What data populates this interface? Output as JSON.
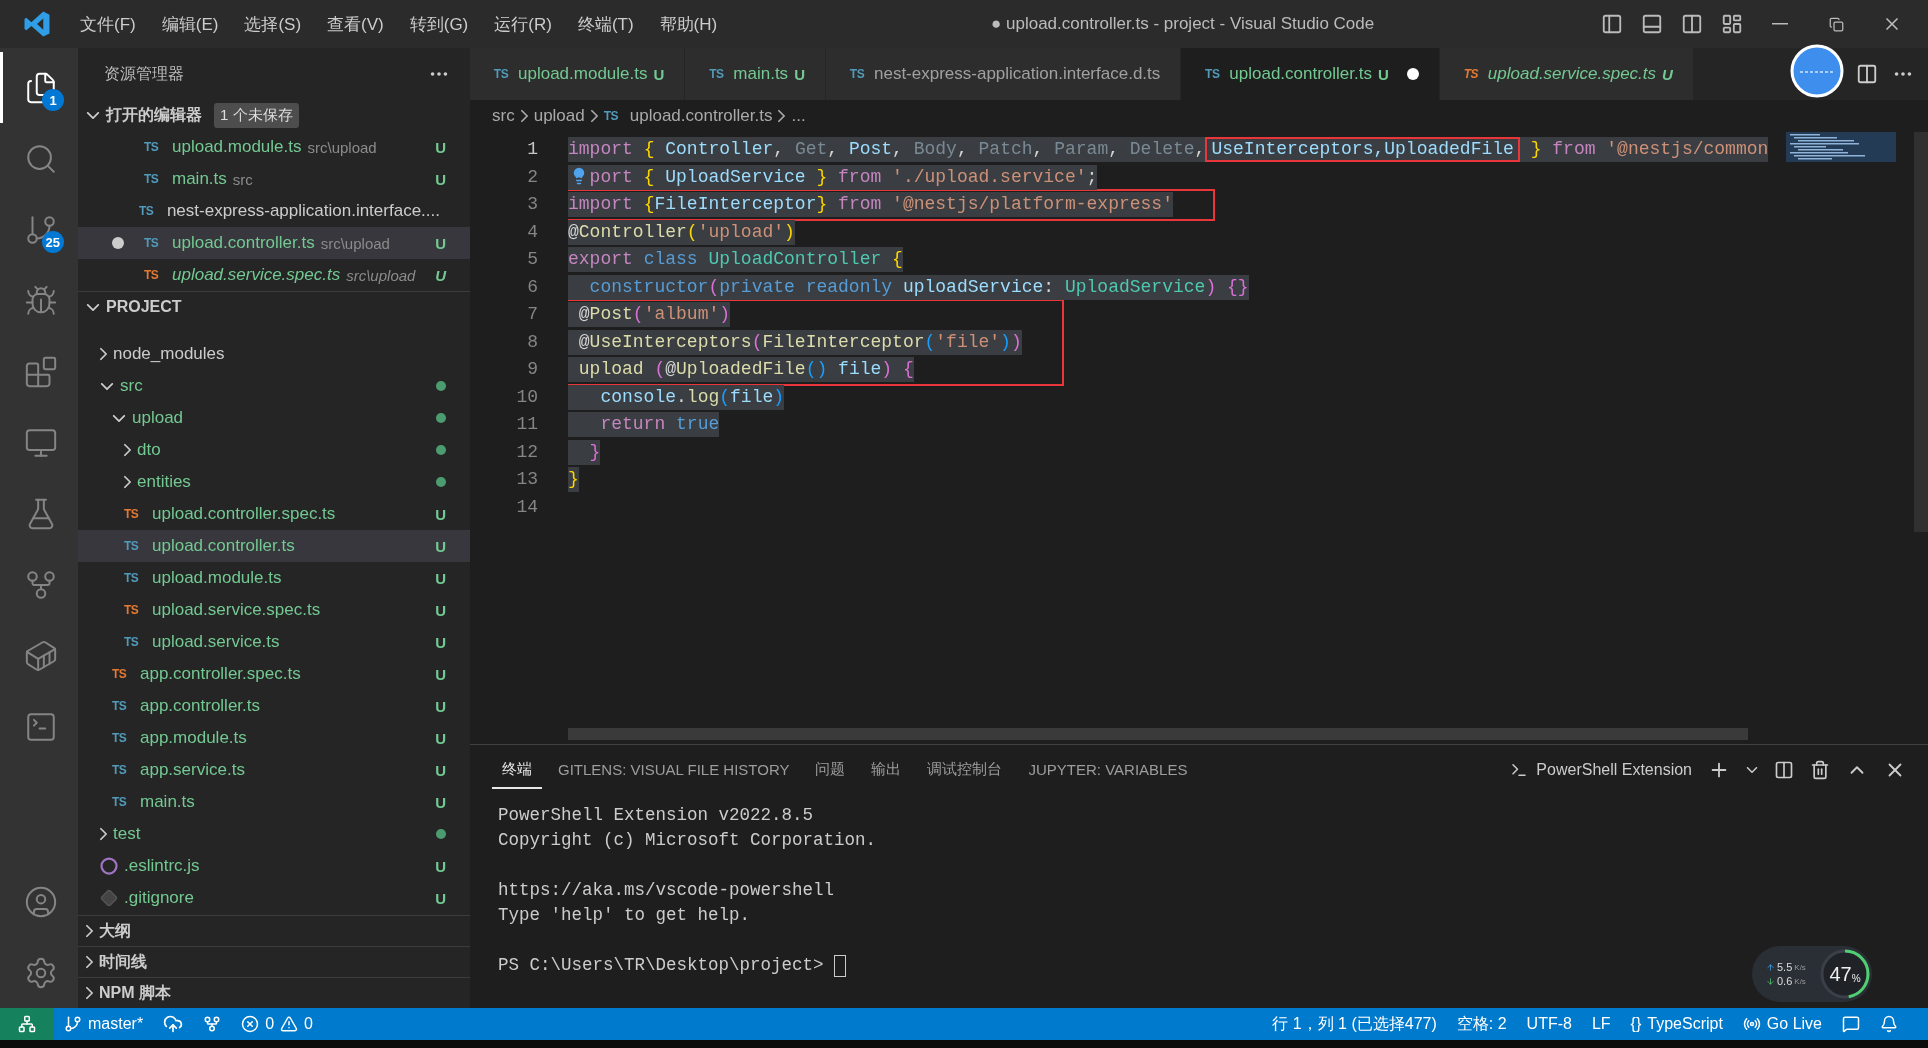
{
  "title_bar": {
    "menu": [
      "文件(F)",
      "编辑(E)",
      "选择(S)",
      "查看(V)",
      "转到(G)",
      "运行(R)",
      "终端(T)",
      "帮助(H)"
    ],
    "title": "● upload.controller.ts - project - Visual Studio Code"
  },
  "activity_bar": {
    "top": [
      {
        "kind": "explorer",
        "badge": "1",
        "selected": true
      },
      {
        "kind": "search",
        "selected": false
      },
      {
        "kind": "scm",
        "badge": "25",
        "selected": false
      },
      {
        "kind": "debug",
        "selected": false
      },
      {
        "kind": "extensions",
        "selected": false
      },
      {
        "kind": "remote",
        "selected": false
      },
      {
        "kind": "testing",
        "selected": false
      },
      {
        "kind": "gitgraph",
        "selected": false
      },
      {
        "kind": "docker",
        "selected": false
      },
      {
        "kind": "terminal",
        "selected": false
      }
    ],
    "bottom": [
      {
        "kind": "account",
        "selected": false
      },
      {
        "kind": "settings",
        "selected": false
      }
    ]
  },
  "sidebar": {
    "title": "资源管理器",
    "open_editors": {
      "title": "打开的编辑器",
      "badge": "1 个未保存",
      "expanded": true,
      "items": [
        {
          "icon": "TS",
          "kind": "ts",
          "name": "upload.module.ts",
          "description": "src\\upload",
          "status": "U",
          "dirty": false,
          "selected": false,
          "preview": false
        },
        {
          "icon": "TS",
          "kind": "ts",
          "name": "main.ts",
          "description": "src",
          "status": "U",
          "dirty": false,
          "selected": false,
          "preview": false
        },
        {
          "icon": "TS",
          "kind": "ts",
          "name": "nest-express-application.interface....",
          "dirty": false,
          "selected": false,
          "preview": false
        },
        {
          "icon": "TS",
          "kind": "ts",
          "name": "upload.controller.ts",
          "description": "src\\upload",
          "status": "U",
          "dirty": true,
          "selected": true,
          "preview": false
        },
        {
          "icon": "TS",
          "kind": "spec",
          "name": "upload.service.spec.ts",
          "description": "src\\upload",
          "status": "U",
          "dirty": false,
          "selected": false,
          "preview": true
        }
      ]
    },
    "project": {
      "title": "PROJECT",
      "expanded": true,
      "tree": [
        {
          "kind": "folder",
          "name": "node_modules",
          "expanded": false,
          "git_dot": false,
          "selected": false
        },
        {
          "kind": "folder",
          "name": "src",
          "expanded": true,
          "git_dot": true,
          "selected": false,
          "children": [
            {
              "kind": "folder",
              "name": "upload",
              "expanded": true,
              "git_dot": true,
              "selected": false,
              "children": [
                {
                  "kind": "folder",
                  "name": "dto",
                  "expanded": false,
                  "git_dot": true,
                  "selected": false
                },
                {
                  "kind": "folder",
                  "name": "entities",
                  "expanded": false,
                  "git_dot": true,
                  "selected": false
                },
                {
                  "kind": "spec",
                  "icon": "TS",
                  "name": "upload.controller.spec.ts",
                  "status": "U",
                  "selected": false
                },
                {
                  "kind": "ts",
                  "icon": "TS",
                  "name": "upload.controller.ts",
                  "status": "U",
                  "selected": true
                },
                {
                  "kind": "ts",
                  "icon": "TS",
                  "name": "upload.module.ts",
                  "status": "U",
                  "selected": false
                },
                {
                  "kind": "spec",
                  "icon": "TS",
                  "name": "upload.service.spec.ts",
                  "status": "U",
                  "selected": false
                },
                {
                  "kind": "ts",
                  "icon": "TS",
                  "name": "upload.service.ts",
                  "status": "U",
                  "selected": false
                }
              ]
            },
            {
              "kind": "spec",
              "icon": "TS",
              "name": "app.controller.spec.ts",
              "status": "U",
              "selected": false
            },
            {
              "kind": "ts",
              "icon": "TS",
              "name": "app.controller.ts",
              "status": "U",
              "selected": false
            },
            {
              "kind": "ts",
              "icon": "TS",
              "name": "app.module.ts",
              "status": "U",
              "selected": false
            },
            {
              "kind": "ts",
              "icon": "TS",
              "name": "app.service.ts",
              "status": "U",
              "selected": false
            },
            {
              "kind": "ts",
              "icon": "TS",
              "name": "main.ts",
              "status": "U",
              "selected": false
            }
          ]
        },
        {
          "kind": "folder",
          "name": "test",
          "expanded": false,
          "git_dot": true,
          "selected": false
        },
        {
          "kind": "eslint",
          "name": ".eslintrc.js",
          "status": "U",
          "selected": false
        },
        {
          "kind": "git",
          "name": ".gitignore",
          "status": "U",
          "selected": false
        }
      ]
    },
    "sections": [
      {
        "title": "大纲",
        "expanded": false
      },
      {
        "title": "时间线",
        "expanded": false
      },
      {
        "title": "NPM 脚本",
        "expanded": false
      }
    ]
  },
  "editor": {
    "tabs": [
      {
        "icon": "TS",
        "kind": "ts",
        "label": "upload.module.ts",
        "status": "U",
        "dirty": false,
        "selected": false,
        "preview": false
      },
      {
        "icon": "TS",
        "kind": "ts",
        "label": "main.ts",
        "status": "U",
        "dirty": false,
        "selected": false,
        "preview": false
      },
      {
        "icon": "TS",
        "kind": "ts",
        "label": "nest-express-application.interface.d.ts",
        "dirty": false,
        "selected": false,
        "preview": false
      },
      {
        "icon": "TS",
        "kind": "ts",
        "label": "upload.controller.ts",
        "status": "U",
        "dirty": true,
        "selected": true,
        "preview": false
      },
      {
        "icon": "TS",
        "kind": "spec",
        "label": "upload.service.spec.ts",
        "status": "U",
        "dirty": false,
        "selected": false,
        "preview": true
      }
    ],
    "breadcrumbs": [
      {
        "kind": "folder",
        "text": "src"
      },
      {
        "kind": "folder",
        "text": "upload"
      },
      {
        "kind": "file",
        "icon": "TS",
        "text": "upload.controller.ts"
      },
      {
        "kind": "more",
        "text": "..."
      }
    ],
    "blocks": [
      {
        "boxed": false,
        "lines": [
          {
            "number": "1",
            "current": true,
            "selected": true,
            "lightbulb": false,
            "tokens": [
              {
                "kind": "keyword",
                "text": "import "
              },
              {
                "kind": "bracket1",
                "text": "{"
              },
              {
                "kind": "variable",
                "text": " Controller"
              },
              {
                "kind": "plain",
                "text": ", "
              },
              {
                "kind": "unused",
                "text": "Get"
              },
              {
                "kind": "plain",
                "text": ", "
              },
              {
                "kind": "variable",
                "text": "Post"
              },
              {
                "kind": "plain",
                "text": ", "
              },
              {
                "kind": "unused",
                "text": "Body"
              },
              {
                "kind": "plain",
                "text": ", "
              },
              {
                "kind": "unused",
                "text": "Patch"
              },
              {
                "kind": "plain",
                "text": ", "
              },
              {
                "kind": "unused",
                "text": "Param"
              },
              {
                "kind": "plain",
                "text": ", "
              },
              {
                "kind": "unused",
                "text": "Delete"
              },
              {
                "kind": "plain",
                "text": ","
              },
              {
                "kind": "variable",
                "text": "UseInterceptors,UploadedFile",
                "boxed": true
              },
              {
                "kind": "bracket1",
                "text": " }"
              },
              {
                "kind": "keyword",
                "text": " from "
              },
              {
                "kind": "string",
                "text": "'@nestjs/common"
              }
            ]
          },
          {
            "number": "2",
            "current": false,
            "selected": true,
            "lightbulb": true,
            "tokens": [
              {
                "kind": "keyword",
                "text": "port "
              },
              {
                "kind": "bracket1",
                "text": "{"
              },
              {
                "kind": "variable",
                "text": " UploadService "
              },
              {
                "kind": "bracket1",
                "text": "}"
              },
              {
                "kind": "keyword",
                "text": " from "
              },
              {
                "kind": "string",
                "text": "'./upload.service'"
              },
              {
                "kind": "plain",
                "text": ";"
              }
            ]
          }
        ]
      },
      {
        "boxed": true,
        "lines": [
          {
            "number": "3",
            "current": false,
            "selected": true,
            "lightbulb": false,
            "tokens": [
              {
                "kind": "keyword",
                "text": "import "
              },
              {
                "kind": "bracket1",
                "text": "{"
              },
              {
                "kind": "variable",
                "text": "FileInterceptor"
              },
              {
                "kind": "bracket1",
                "text": "}"
              },
              {
                "kind": "keyword",
                "text": " from "
              },
              {
                "kind": "string",
                "text": "'@nestjs/platform-express'"
              }
            ]
          }
        ]
      },
      {
        "boxed": false,
        "lines": [
          {
            "number": "4",
            "current": false,
            "selected": true,
            "lightbulb": false,
            "tokens": [
              {
                "kind": "plain",
                "text": "@"
              },
              {
                "kind": "function",
                "text": "Controller"
              },
              {
                "kind": "bracket1",
                "text": "("
              },
              {
                "kind": "string",
                "text": "'upload'"
              },
              {
                "kind": "bracket1",
                "text": ")"
              }
            ]
          },
          {
            "number": "5",
            "current": false,
            "selected": true,
            "lightbulb": false,
            "tokens": [
              {
                "kind": "keyword",
                "text": "export "
              },
              {
                "kind": "storage",
                "text": "class "
              },
              {
                "kind": "type",
                "text": "UploadController "
              },
              {
                "kind": "bracket1",
                "text": "{"
              }
            ]
          },
          {
            "number": "6",
            "current": false,
            "selected": true,
            "lightbulb": false,
            "tokens": [
              {
                "kind": "storage",
                "text": "  constructor"
              },
              {
                "kind": "bracket2",
                "text": "("
              },
              {
                "kind": "storage",
                "text": "private readonly "
              },
              {
                "kind": "variable",
                "text": "uploadService"
              },
              {
                "kind": "plain",
                "text": ": "
              },
              {
                "kind": "type",
                "text": "UploadService"
              },
              {
                "kind": "bracket2",
                "text": ") {}"
              }
            ]
          }
        ]
      },
      {
        "boxed": true,
        "lines": [
          {
            "number": "7",
            "current": false,
            "selected": true,
            "lightbulb": false,
            "tokens": [
              {
                "kind": "plain",
                "text": " @"
              },
              {
                "kind": "function",
                "text": "Post"
              },
              {
                "kind": "bracket2",
                "text": "("
              },
              {
                "kind": "string",
                "text": "'album'"
              },
              {
                "kind": "bracket2",
                "text": ")"
              }
            ]
          },
          {
            "number": "8",
            "current": false,
            "selected": true,
            "lightbulb": false,
            "tokens": [
              {
                "kind": "plain",
                "text": " @"
              },
              {
                "kind": "function",
                "text": "UseInterceptors"
              },
              {
                "kind": "bracket2",
                "text": "("
              },
              {
                "kind": "function",
                "text": "FileInterceptor"
              },
              {
                "kind": "bracket3",
                "text": "("
              },
              {
                "kind": "string",
                "text": "'file'"
              },
              {
                "kind": "bracket3",
                "text": ")"
              },
              {
                "kind": "bracket2",
                "text": ")"
              }
            ]
          },
          {
            "number": "9",
            "current": false,
            "selected": true,
            "lightbulb": false,
            "tokens": [
              {
                "kind": "function",
                "text": " upload "
              },
              {
                "kind": "bracket2",
                "text": "("
              },
              {
                "kind": "plain",
                "text": "@"
              },
              {
                "kind": "function",
                "text": "UploadedFile"
              },
              {
                "kind": "bracket3",
                "text": "() "
              },
              {
                "kind": "variable",
                "text": "file"
              },
              {
                "kind": "bracket2",
                "text": ") {"
              }
            ]
          }
        ]
      },
      {
        "boxed": false,
        "lines": [
          {
            "number": "10",
            "current": false,
            "selected": true,
            "lightbulb": false,
            "tokens": [
              {
                "kind": "variable",
                "text": "   console"
              },
              {
                "kind": "plain",
                "text": "."
              },
              {
                "kind": "function",
                "text": "log"
              },
              {
                "kind": "bracket3",
                "text": "("
              },
              {
                "kind": "variable",
                "text": "file"
              },
              {
                "kind": "bracket3",
                "text": ")"
              }
            ]
          },
          {
            "number": "11",
            "current": false,
            "selected": true,
            "lightbulb": false,
            "tokens": [
              {
                "kind": "keyword",
                "text": "   return "
              },
              {
                "kind": "storage",
                "text": "true"
              }
            ]
          },
          {
            "number": "12",
            "current": false,
            "selected": true,
            "lightbulb": false,
            "tokens": [
              {
                "kind": "bracket2",
                "text": "  }"
              }
            ]
          },
          {
            "number": "13",
            "current": false,
            "selected": true,
            "lightbulb": false,
            "tokens": [
              {
                "kind": "bracket1",
                "text": "}"
              }
            ]
          },
          {
            "number": "14",
            "current": false,
            "selected": false,
            "lightbulb": false
          }
        ]
      }
    ]
  },
  "panel": {
    "tabs": [
      {
        "label": "终端",
        "selected": true
      },
      {
        "label": "GITLENS: VISUAL FILE HISTORY",
        "selected": false
      },
      {
        "label": "问题",
        "selected": false
      },
      {
        "label": "输出",
        "selected": false
      },
      {
        "label": "调试控制台",
        "selected": false
      },
      {
        "label": "JUPYTER: VARIABLES",
        "selected": false
      }
    ],
    "terminal_name": "PowerShell Extension",
    "output": [
      [
        "PowerShell Extension v2022.8.5",
        "Copyright (c) Microsoft Corporation."
      ],
      [
        "https://aka.ms/vscode-powershell",
        "Type 'help' to get help."
      ]
    ],
    "prompt": "PS C:\\Users\\TR\\Desktop\\project>"
  },
  "speed_widget": {
    "rates": [
      {
        "kind": "up",
        "value": "5.5",
        "unit": "K/s"
      },
      {
        "kind": "down",
        "value": "0.6",
        "unit": "K/s"
      }
    ],
    "percent": "47",
    "percent_sign": "%",
    "level": 0.47
  },
  "status_bar": {
    "left": [
      {
        "kind": "remote"
      },
      {
        "kind": "branch",
        "text": "master*"
      },
      {
        "kind": "sync"
      },
      {
        "kind": "graph"
      },
      {
        "kind": "problems",
        "errors": "0",
        "warnings": "0"
      }
    ],
    "right": [
      {
        "kind": "text",
        "text": "行 1，列 1 (已选择477)"
      },
      {
        "kind": "text",
        "text": "空格: 2"
      },
      {
        "kind": "text",
        "text": "UTF-8"
      },
      {
        "kind": "text",
        "text": "LF"
      },
      {
        "kind": "language",
        "icon": "{}",
        "text": "TypeScript"
      },
      {
        "kind": "golive",
        "text": "Go Live"
      },
      {
        "kind": "feedback"
      },
      {
        "kind": "bell"
      }
    ]
  }
}
